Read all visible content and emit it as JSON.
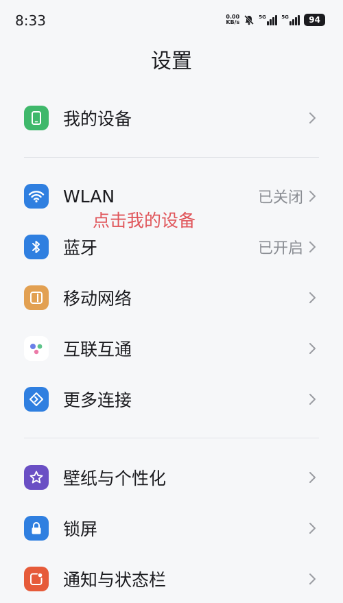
{
  "status": {
    "time": "8:33",
    "net_speed_value": "0.00",
    "net_speed_unit": "KB/s",
    "sim1_label": "5G",
    "sim2_label": "5G",
    "battery": "94"
  },
  "header": {
    "title": "设置"
  },
  "annotation": "点击我的设备",
  "items": [
    {
      "label": "我的设备",
      "value": "",
      "icon": "phone-icon",
      "color": "#3fb86b"
    },
    {
      "label": "WLAN",
      "value": "已关闭",
      "icon": "wifi-icon",
      "color": "#2f7fe0"
    },
    {
      "label": "蓝牙",
      "value": "已开启",
      "icon": "bluetooth-icon",
      "color": "#2f7fe0"
    },
    {
      "label": "移动网络",
      "value": "",
      "icon": "mobile-network-icon",
      "color": "#e2a052"
    },
    {
      "label": "互联互通",
      "value": "",
      "icon": "interconnect-icon",
      "color": "#ffffff"
    },
    {
      "label": "更多连接",
      "value": "",
      "icon": "more-connection-icon",
      "color": "#2f7fe0"
    },
    {
      "label": "壁纸与个性化",
      "value": "",
      "icon": "star-icon",
      "color": "#6a4fc4"
    },
    {
      "label": "锁屏",
      "value": "",
      "icon": "lock-icon",
      "color": "#2f7fe0"
    },
    {
      "label": "通知与状态栏",
      "value": "",
      "icon": "notification-icon",
      "color": "#e65b3a"
    }
  ]
}
